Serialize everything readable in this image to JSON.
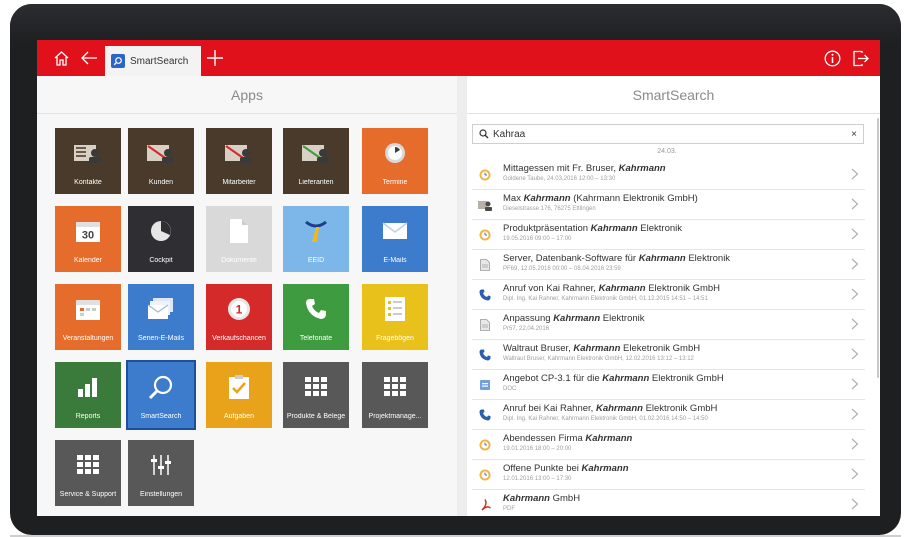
{
  "window": {
    "tab_label": "SmartSearch"
  },
  "left_pane": {
    "title": "Apps"
  },
  "right_pane": {
    "title": "SmartSearch"
  },
  "search": {
    "value": "Kahraa",
    "clear_icon": "×"
  },
  "date_separator": "24.03.",
  "colors": {
    "brand_red": "#e0111a",
    "brown": "#4a3a2c",
    "orange": "#e56c2a",
    "blue": "#3d7bcc",
    "dark": "#2f2f33",
    "grey": "#d9d9d9",
    "light_blue": "#7db6e8",
    "red": "#d42a2a",
    "green": "#3e9b3f",
    "yellow": "#e8c11a",
    "dark_green": "#3a7a3a",
    "gold": "#e8a31a",
    "mid_grey": "#585858"
  },
  "apps": [
    {
      "label": "Kontakte",
      "icon": "contacts-icon",
      "color": "#4a3a2c"
    },
    {
      "label": "Kunden",
      "icon": "customers-icon",
      "color": "#4a3a2c"
    },
    {
      "label": "Mitarbeiter",
      "icon": "employees-icon",
      "color": "#4a3a2c"
    },
    {
      "label": "Lieferanten",
      "icon": "suppliers-icon",
      "color": "#4a3a2c"
    },
    {
      "label": "Termine",
      "icon": "appointments-icon",
      "color": "#e56c2a"
    },
    {
      "label": "Kalender",
      "icon": "calendar-icon",
      "color": "#e56c2a",
      "icon_text": "30"
    },
    {
      "label": "Cockpit",
      "icon": "cockpit-icon",
      "color": "#2f2f33"
    },
    {
      "label": "Dokumente",
      "icon": "documents-icon",
      "color": "#d9d9d9"
    },
    {
      "label": "EEID",
      "icon": "eeid-icon",
      "color": "#7db6e8"
    },
    {
      "label": "E-Mails",
      "icon": "email-icon",
      "color": "#3d7bcc"
    },
    {
      "label": "Veranstaltungen",
      "icon": "events-icon",
      "color": "#e56c2a"
    },
    {
      "label": "Serien-E-Mails",
      "icon": "bulk-email-icon",
      "color": "#3d7bcc"
    },
    {
      "label": "Verkaufschancen",
      "icon": "sales-opportunities-icon",
      "color": "#d42a2a",
      "icon_text": "1"
    },
    {
      "label": "Telefonate",
      "icon": "phone-icon",
      "color": "#3e9b3f"
    },
    {
      "label": "Fragebögen",
      "icon": "questionnaire-icon",
      "color": "#e8c11a"
    },
    {
      "label": "Reports",
      "icon": "reports-icon",
      "color": "#3a7a3a"
    },
    {
      "label": "SmartSearch",
      "icon": "search-icon",
      "color": "#3d7bcc"
    },
    {
      "label": "Aufgaben",
      "icon": "tasks-icon",
      "color": "#e8a31a"
    },
    {
      "label": "Produkte & Belege",
      "icon": "products-icon",
      "color": "#585858"
    },
    {
      "label": "Projektmanage...",
      "icon": "projects-icon",
      "color": "#585858"
    },
    {
      "label": "Service & Support",
      "icon": "service-icon",
      "color": "#585858"
    },
    {
      "label": "Einstellungen",
      "icon": "settings-icon",
      "color": "#585858"
    }
  ],
  "results": [
    {
      "icon": "appointment-icon",
      "pre": "Mittagessen mit Fr. Bruser, ",
      "bold": "Kahrmann",
      "post": "",
      "sub": "Goldene Taube, 24.03.2016 12:00 – 13:30"
    },
    {
      "icon": "contact-icon",
      "pre": "Max ",
      "bold": "Kahrmann",
      "post": " (Kahrmann Elektronik GmbH)",
      "sub": "Dieselstrasse 176, 76275 Ettlingen"
    },
    {
      "icon": "appointment-icon",
      "pre": "Produktpräsentation ",
      "bold": "Kahrmann",
      "post": " Elektronik",
      "sub": "19.05.2016 09:00 – 17:00"
    },
    {
      "icon": "document-icon",
      "pre": "Server, Datenbank-Software für ",
      "bold": "Kahrmann",
      "post": " Elektronik",
      "sub": "PF69, 12.05.2016 00:00 – 08.04.2016 23:59"
    },
    {
      "icon": "phone-icon",
      "pre": "Anruf von Kai Rahner, ",
      "bold": "Kahrmann",
      "post": " Elektronik GmbH",
      "sub": "Dipl. Ing. Kai Rahner, Kahrmann Elektronik GmbH, 01.12.2015 14:51 – 14:51"
    },
    {
      "icon": "document-icon",
      "pre": "Anpassung ",
      "bold": "Kahrmann",
      "post": " Elektronik",
      "sub": "Pr57, 22.04.2016"
    },
    {
      "icon": "phone-icon",
      "pre": "Waltraut Bruser, ",
      "bold": "Kahrmann",
      "post": " Eleketronik GmbH",
      "sub": "Waltraut Bruser, Kahrmann Elektronik GmbH, 12.02.2016 13:12 – 13:12"
    },
    {
      "icon": "offer-icon",
      "pre": "Angebot CP-3.1 für die ",
      "bold": "Kahrmann",
      "post": " Elektronik GmbH",
      "sub": "DOC"
    },
    {
      "icon": "phone-icon",
      "pre": "Anruf bei Kai Rahner, ",
      "bold": "Kahrmann",
      "post": " Elektronik GmbH",
      "sub": "Dipl. Ing. Kai Rahner, Kahrmann Elektronik GmbH, 01.02.2016 14:50 – 14:50"
    },
    {
      "icon": "appointment-icon",
      "pre": "Abendessen Firma ",
      "bold": "Kahrmann",
      "post": "",
      "sub": "19.01.2016 18:00 – 20:00"
    },
    {
      "icon": "appointment-icon",
      "pre": "Offene Punkte bei ",
      "bold": "Kahrmann",
      "post": "",
      "sub": "12.01.2016 13:00 – 17:30"
    },
    {
      "icon": "pdf-icon",
      "pre": "",
      "bold": "Kahrmann",
      "post": " GmbH",
      "sub": "PDF"
    }
  ]
}
